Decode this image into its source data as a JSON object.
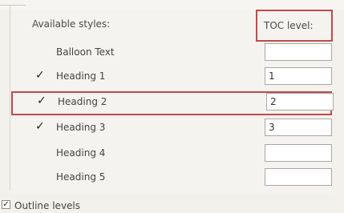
{
  "header": {
    "available_styles_label": "Available styles:",
    "toc_level_label": "TOC level:"
  },
  "styles": [
    {
      "name": "Balloon Text",
      "checked": false,
      "level": ""
    },
    {
      "name": "Heading 1",
      "checked": true,
      "level": "1"
    },
    {
      "name": "Heading 2",
      "checked": true,
      "level": "2"
    },
    {
      "name": "Heading 3",
      "checked": true,
      "level": "3"
    },
    {
      "name": "Heading 4",
      "checked": false,
      "level": ""
    },
    {
      "name": "Heading 5",
      "checked": false,
      "level": ""
    }
  ],
  "check_glyph": "✓",
  "outline_levels": {
    "label": "Outline levels",
    "checked": true
  },
  "colors": {
    "highlight_border": "#c24a4a",
    "panel_bg": "#f4f3ef"
  }
}
